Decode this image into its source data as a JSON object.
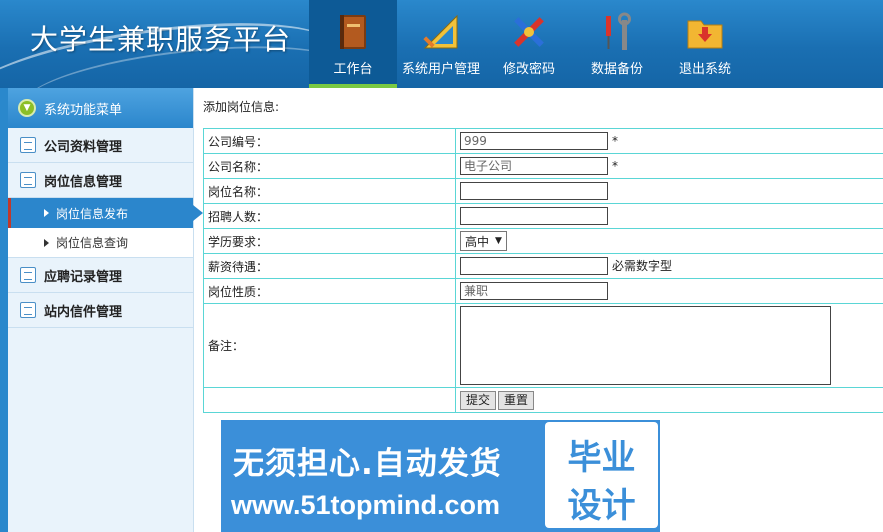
{
  "header": {
    "app_title": "大学生兼职服务平台",
    "nav": [
      {
        "label": "工作台",
        "icon": "book-icon",
        "active": true
      },
      {
        "label": "系统用户管理",
        "icon": "ruler-triangle-icon",
        "active": false
      },
      {
        "label": "修改密码",
        "icon": "tools-cross-icon",
        "active": false
      },
      {
        "label": "数据备份",
        "icon": "screwdriver-wrench-icon",
        "active": false
      },
      {
        "label": "退出系统",
        "icon": "folder-download-icon",
        "active": false
      }
    ]
  },
  "sidebar": {
    "title": "系统功能菜单",
    "groups": [
      {
        "label": "公司资料管理"
      },
      {
        "label": "岗位信息管理",
        "items": [
          {
            "label": "岗位信息发布",
            "active": true
          },
          {
            "label": "岗位信息查询",
            "active": false
          }
        ]
      },
      {
        "label": "应聘记录管理"
      },
      {
        "label": "站内信件管理"
      }
    ]
  },
  "main": {
    "title": "添加岗位信息:",
    "fields": {
      "company_no": {
        "label": "公司编号：",
        "value": "999",
        "required_mark": "*"
      },
      "company_name": {
        "label": "公司名称：",
        "value": "电子公司",
        "required_mark": "*"
      },
      "job_name": {
        "label": "岗位名称：",
        "value": ""
      },
      "headcount": {
        "label": "招聘人数：",
        "value": ""
      },
      "education": {
        "label": "学历要求：",
        "selected": "高中"
      },
      "salary": {
        "label": "薪资待遇：",
        "value": "",
        "hint": "必需数字型"
      },
      "job_type": {
        "label": "岗位性质：",
        "value": "兼职"
      },
      "remark": {
        "label": "备注：",
        "value": ""
      }
    },
    "buttons": {
      "submit": "提交",
      "reset": "重置"
    }
  },
  "watermark": {
    "line1": "无须担心.自动发货",
    "line2": "www.51topmind.com",
    "badge_line1": "毕业",
    "badge_line2": "设计"
  },
  "colors": {
    "header_blue": "#1a6fb2",
    "active_green": "#7ac943",
    "table_border": "#5ad6d6",
    "sidebar_active": "#2b86cc"
  }
}
